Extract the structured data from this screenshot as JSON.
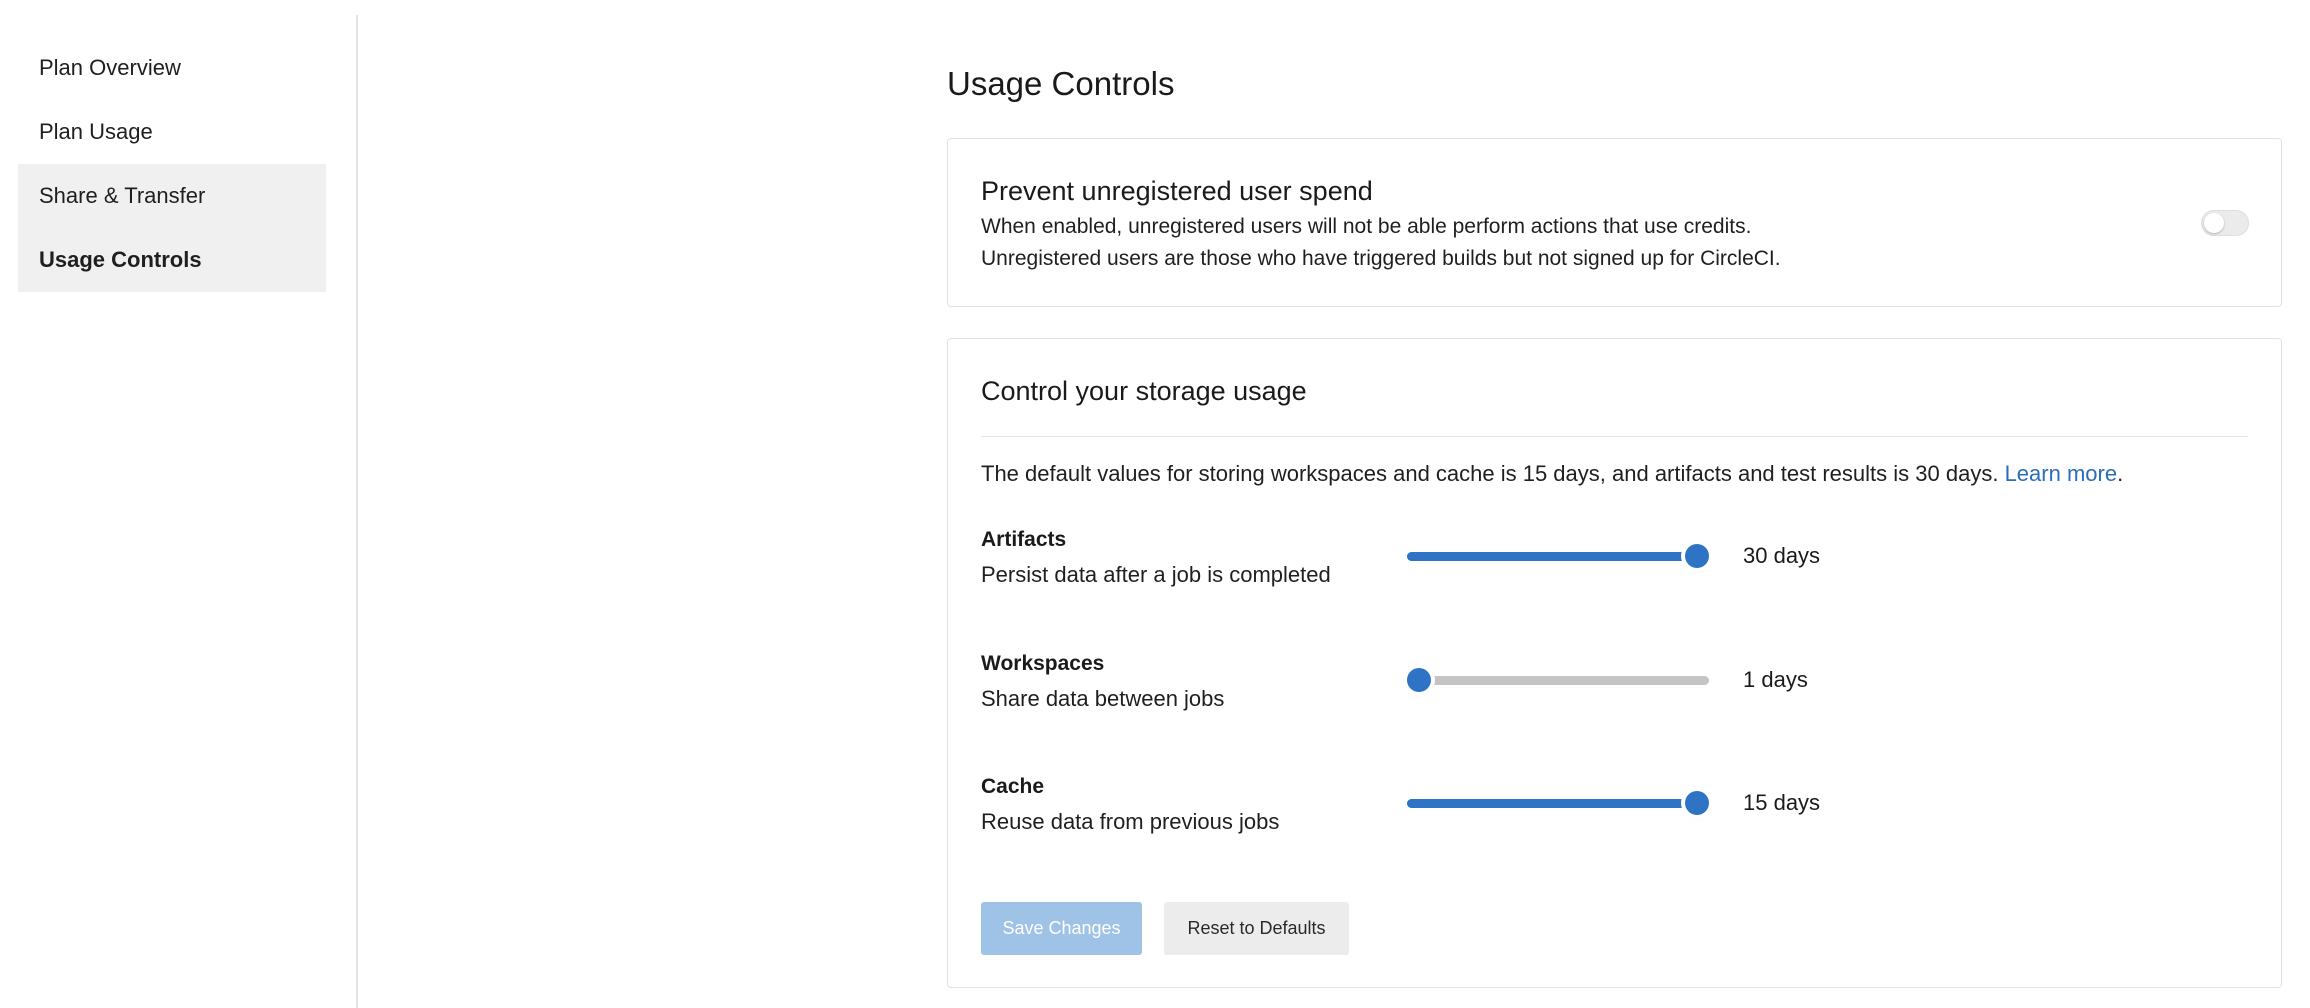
{
  "sidebar": {
    "items": [
      {
        "label": "Plan Overview"
      },
      {
        "label": "Plan Usage"
      },
      {
        "label": "Share & Transfer"
      },
      {
        "label": "Usage Controls"
      }
    ]
  },
  "main": {
    "title": "Usage Controls",
    "unregistered": {
      "title": "Prevent unregistered user spend",
      "desc_line1": "When enabled, unregistered users will not be able perform actions that use credits.",
      "desc_line2": "Unregistered users are those who have triggered builds but not signed up for CircleCI.",
      "toggle_on": false
    },
    "storage": {
      "title": "Control your storage usage",
      "intro": "The default values for storing workspaces and cache is 15 days, and artifacts and test results is 30 days.",
      "learn_more": "Learn more",
      "intro_end": ".",
      "rows": [
        {
          "label": "Artifacts",
          "desc": "Persist data after a job is completed",
          "value_text": "30 days",
          "level": 1.0
        },
        {
          "label": "Workspaces",
          "desc": "Share data between jobs",
          "value_text": "1 days",
          "level": 0.0
        },
        {
          "label": "Cache",
          "desc": "Reuse data from previous jobs",
          "value_text": "15 days",
          "level": 1.0
        }
      ],
      "save_label": "Save Changes",
      "reset_label": "Reset to Defaults"
    }
  },
  "colors": {
    "accent": "#2e73c4",
    "link": "#2c6cb8",
    "save_disabled": "#9fc2e7",
    "track": "#c4c4c4",
    "sidebar_active_bg": "#f0f0f0"
  }
}
